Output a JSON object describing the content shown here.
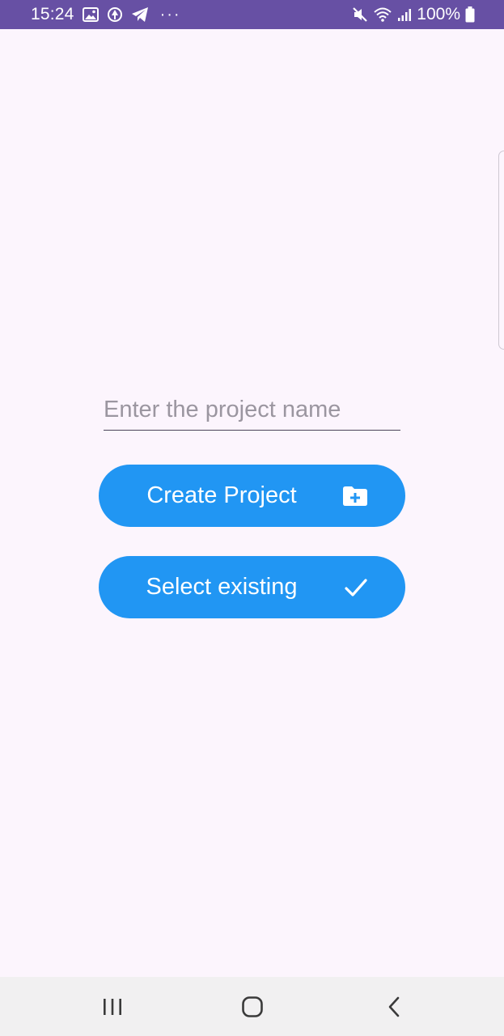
{
  "status_bar": {
    "time": "15:24",
    "battery": "100%",
    "more": "···",
    "left_icons": [
      "gallery-icon",
      "vpn-icon",
      "telegram-icon"
    ],
    "right_icons": [
      "mute-icon",
      "wifi-icon",
      "signal-icon",
      "battery-icon"
    ],
    "background": "#6750a4"
  },
  "main": {
    "project_input": {
      "placeholder": "Enter the project name",
      "value": ""
    },
    "create_button": {
      "label": "Create Project",
      "icon": "folder-add-icon"
    },
    "select_button": {
      "label": "Select existing",
      "icon": "check-icon"
    },
    "button_color": "#2196f3"
  },
  "nav_bar": {
    "buttons": [
      "recents-icon",
      "home-icon",
      "back-icon"
    ]
  }
}
